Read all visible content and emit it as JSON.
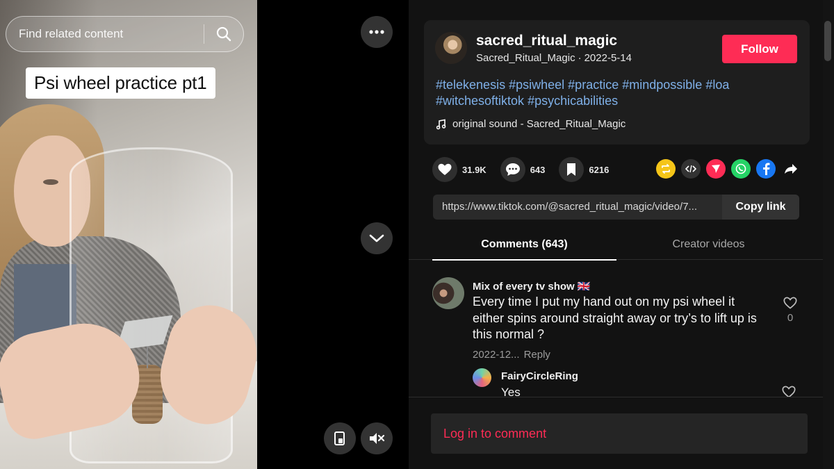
{
  "video": {
    "search_placeholder": "Find related content",
    "caption": "Psi wheel practice pt1"
  },
  "controls": {
    "more_icon": "more-icon",
    "next_icon": "chevron-down-icon",
    "mini_icon": "mini-player-icon",
    "mute_icon": "muted-speaker-icon"
  },
  "post": {
    "username": "sacred_ritual_magic",
    "display_name": "Sacred_Ritual_Magic",
    "separator": "·",
    "date": "2022-5-14",
    "follow_label": "Follow",
    "hashtags_line1": [
      "#telekenesis",
      "#psiwheel",
      "#practice",
      "#mindpossible",
      "#loa"
    ],
    "hashtags_line2": [
      "#witchesoftiktok",
      "#psychicabilities"
    ],
    "sound": "original sound - Sacred_Ritual_Magic"
  },
  "stats": {
    "likes": "31.9K",
    "comments": "643",
    "saves": "6216"
  },
  "share": {
    "icons": [
      "repost-icon",
      "embed-icon",
      "send-icon",
      "whatsapp-icon",
      "facebook-icon",
      "share-arrow-icon"
    ]
  },
  "link": {
    "url": "https://www.tiktok.com/@sacred_ritual_magic/video/7...",
    "copy_label": "Copy link"
  },
  "tabs": {
    "comments": "Comments (643)",
    "creator": "Creator videos"
  },
  "comments": [
    {
      "user": "Mix of every tv show 🇬🇧",
      "text": "Every time I put my hand out on my psi wheel it either spins around straight away or try’s to lift up is this normal ?",
      "date": "2022-12...",
      "reply_label": "Reply",
      "likes": "0"
    }
  ],
  "replies": [
    {
      "user": "FairyCircleRing",
      "text": "Yes"
    }
  ],
  "login_label": "Log in to comment",
  "colors": {
    "accent": "#fe2c55",
    "hashtag": "#7fb0e8",
    "panel_bg": "#121212",
    "card_bg": "#1e1e1e"
  }
}
